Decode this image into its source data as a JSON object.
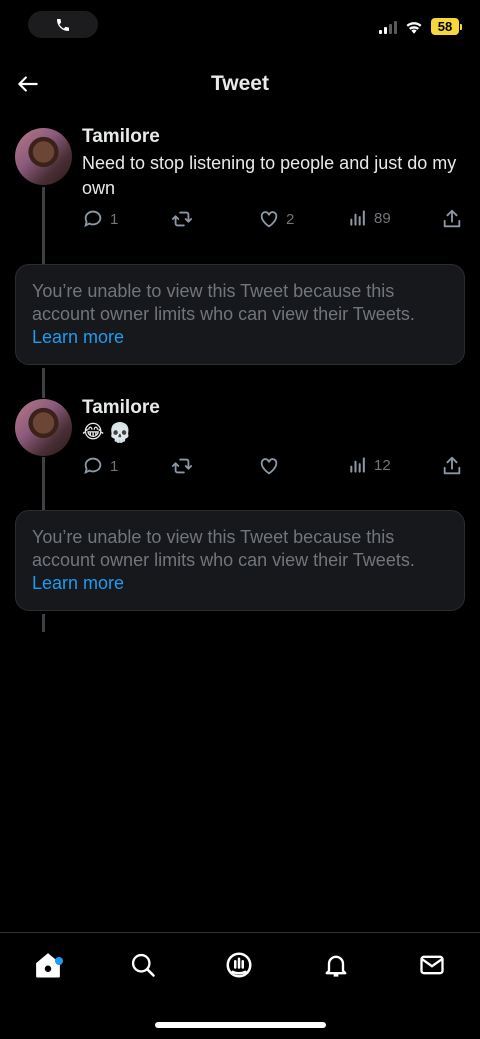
{
  "status_bar": {
    "battery": "58"
  },
  "header": {
    "title": "Tweet"
  },
  "tweets": [
    {
      "name": "Tamilore",
      "text": "Need to stop listening to people and just do my own",
      "replies": "1",
      "retweets": "",
      "likes": "2",
      "views": "89"
    },
    {
      "name": "Tamilore",
      "emojis": [
        "😂",
        "💀"
      ],
      "replies": "1",
      "retweets": "",
      "likes": "",
      "views": "12"
    }
  ],
  "notices": [
    {
      "text": "You’re unable to view this Tweet because this account owner limits who can view their Tweets.",
      "link": "Learn more"
    },
    {
      "text": "You’re unable to view this Tweet because this account owner limits who can view their Tweets.",
      "link": "Learn more"
    }
  ],
  "colors": {
    "accent": "#1d9bf0",
    "muted": "#71767b",
    "battery": "#f5d63d"
  },
  "nav": {
    "items": [
      "home-icon",
      "search-icon",
      "spaces-icon",
      "notifications-icon",
      "messages-icon"
    ],
    "home_has_dot": true
  }
}
